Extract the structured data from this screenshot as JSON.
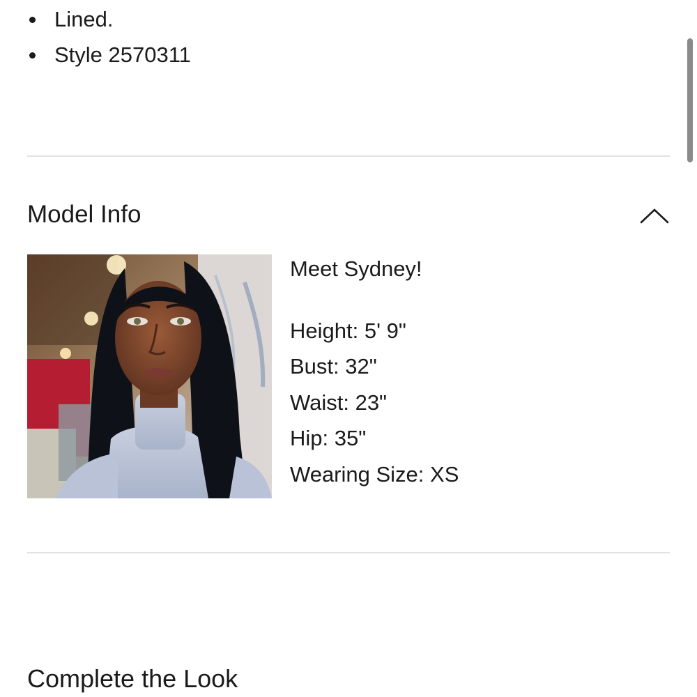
{
  "details": {
    "bullets": [
      "Lined.",
      "Style 2570311"
    ]
  },
  "model_info": {
    "title": "Model Info",
    "toggle_icon": "chevron-up-icon",
    "intro": "Meet Sydney!",
    "stats": {
      "height": "Height: 5' 9\"",
      "bust": "Bust: 32\"",
      "waist": "Waist: 23\"",
      "hip": "Hip: 35\"",
      "wearing_size": "Wearing Size: XS"
    }
  },
  "complete_the_look": {
    "title": "Complete the Look"
  },
  "colors": {
    "text": "#1a1a1a",
    "divider": "#e3e3e3",
    "scrollbar": "#8a8a8a",
    "background": "#ffffff"
  }
}
